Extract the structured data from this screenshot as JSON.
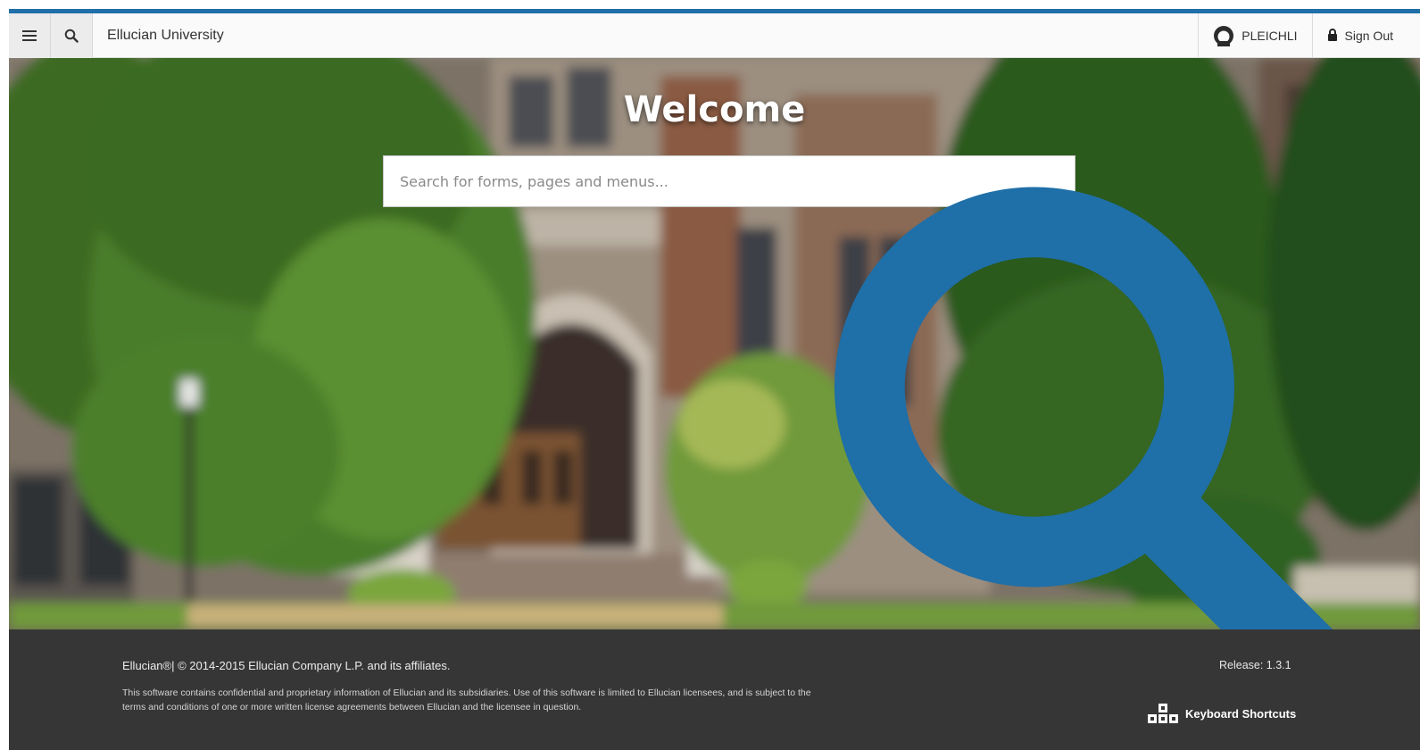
{
  "header": {
    "app_title": "Ellucian University",
    "user_name": "PLEICHLI",
    "sign_out_label": "Sign Out",
    "menu_icon": "hamburger-menu-icon",
    "search_icon": "search-icon",
    "user_icon": "user-avatar-icon",
    "lock_icon": "lock-icon"
  },
  "hero": {
    "welcome_text": "Welcome",
    "search_placeholder": "Search for forms, pages and menus..."
  },
  "footer": {
    "copyright": "Ellucian®| © 2014-2015 Ellucian Company L.P. and its affiliates.",
    "legal_line_1": "This software contains confidential and proprietary information of Ellucian and its subsidiaries. Use of this software is limited to Ellucian licensees, and is subject to the",
    "legal_line_2": "terms and conditions of one or more written license agreements between Ellucian and the licensee in question.",
    "release": "Release: 1.3.1",
    "keyboard_shortcuts": "Keyboard Shortcuts"
  },
  "colors": {
    "accent": "#1f6fa8",
    "footer_bg": "#363636",
    "search_icon": "#1f6fa8"
  }
}
